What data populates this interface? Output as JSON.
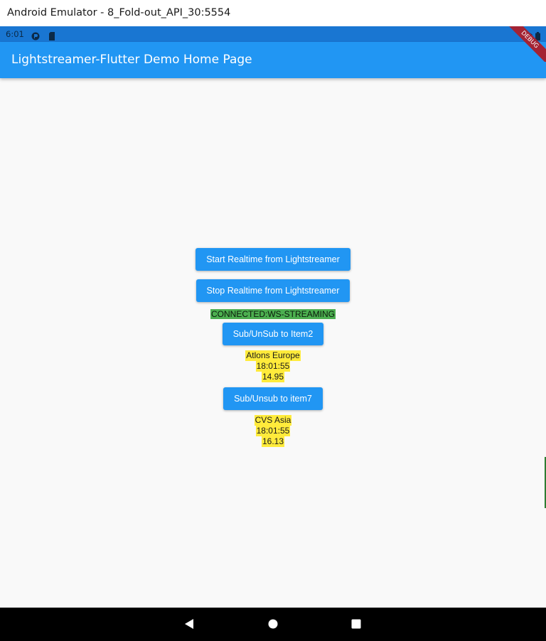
{
  "window": {
    "title": "Android Emulator - 8_Fold-out_API_30:5554"
  },
  "statusbar": {
    "time": "6:01"
  },
  "appbar": {
    "title": "Lightstreamer-Flutter Demo Home Page",
    "debug_banner": "DEBUG"
  },
  "controls": {
    "start_label": "Start Realtime from Lightstreamer",
    "stop_label": "Stop Realtime from Lightstreamer",
    "connection_status": "CONNECTED:WS-STREAMING"
  },
  "items": [
    {
      "button_label": "Sub/UnSub to Item2",
      "name": "Atlons Europe",
      "time": "18:01:55",
      "price": "14.95"
    },
    {
      "button_label": "Sub/Unsub to item7",
      "name": "CVS Asia",
      "time": "18:01:55",
      "price": "16.13"
    }
  ],
  "colors": {
    "primary": "#2196f3",
    "status_bar": "#1976d2",
    "connected_bg": "#4caf50",
    "quote_bg": "#ffeb3b",
    "debug_banner": "#a32334"
  },
  "icons": [
    "back-icon",
    "home-icon",
    "recents-icon",
    "wifi-icon",
    "battery-icon",
    "sim-icon",
    "notification-icon"
  ]
}
